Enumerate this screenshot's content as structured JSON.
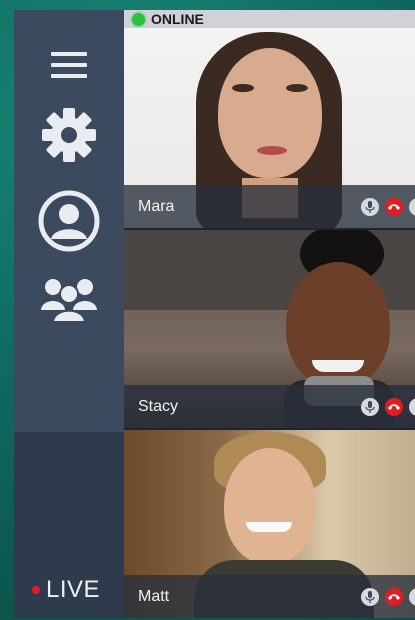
{
  "status": {
    "label": "ONLINE",
    "color": "#29c23b"
  },
  "sidebar": {
    "icons": [
      "menu-icon",
      "settings-gear-icon",
      "user-profile-icon",
      "group-icon"
    ],
    "live_label": "LIVE",
    "live_color": "#e01d2a"
  },
  "participants": [
    {
      "name": "Mara",
      "controls": [
        "mic-icon",
        "hang-up-icon"
      ]
    },
    {
      "name": "Stacy",
      "controls": [
        "mic-icon",
        "hang-up-icon"
      ]
    },
    {
      "name": "Matt",
      "controls": [
        "mic-icon",
        "hang-up-icon"
      ]
    }
  ],
  "colors": {
    "sidebar": "#3b4a5e",
    "hangup": "#e31b23"
  }
}
